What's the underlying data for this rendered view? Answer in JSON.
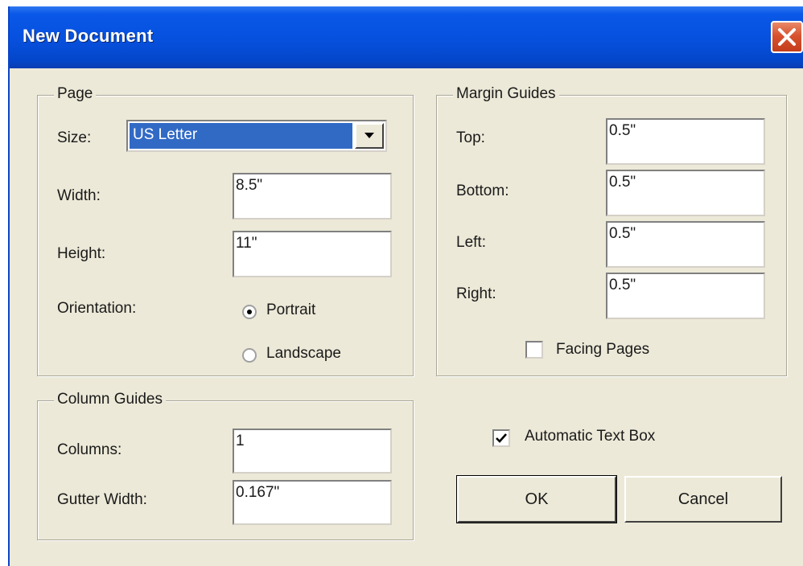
{
  "dialog": {
    "title": "New Document"
  },
  "page": {
    "legend": "Page",
    "size_label": "Size:",
    "size_value": "US Letter",
    "width_label": "Width:",
    "width_value": "8.5\"",
    "height_label": "Height:",
    "height_value": "11\"",
    "orientation_label": "Orientation:",
    "portrait_label": "Portrait",
    "landscape_label": "Landscape",
    "orientation_selected": "Portrait"
  },
  "margins": {
    "legend": "Margin Guides",
    "top_label": "Top:",
    "top_value": "0.5\"",
    "bottom_label": "Bottom:",
    "bottom_value": "0.5\"",
    "left_label": "Left:",
    "left_value": "0.5\"",
    "right_label": "Right:",
    "right_value": "0.5\"",
    "facing_pages_label": "Facing Pages",
    "facing_pages_checked": false
  },
  "columns": {
    "legend": "Column Guides",
    "columns_label": "Columns:",
    "columns_value": "1",
    "gutter_label": "Gutter Width:",
    "gutter_value": "0.167\""
  },
  "options": {
    "automatic_text_box_label": "Automatic Text Box",
    "automatic_text_box_checked": true
  },
  "buttons": {
    "ok": "OK",
    "cancel": "Cancel"
  },
  "icons": {
    "close": "close-icon",
    "dropdown": "chevron-down-icon",
    "check": "checkmark-icon"
  },
  "colors": {
    "titlebar": "#0650dd",
    "face": "#ece9d8",
    "selection": "#316ac5",
    "close": "#d8522f"
  }
}
